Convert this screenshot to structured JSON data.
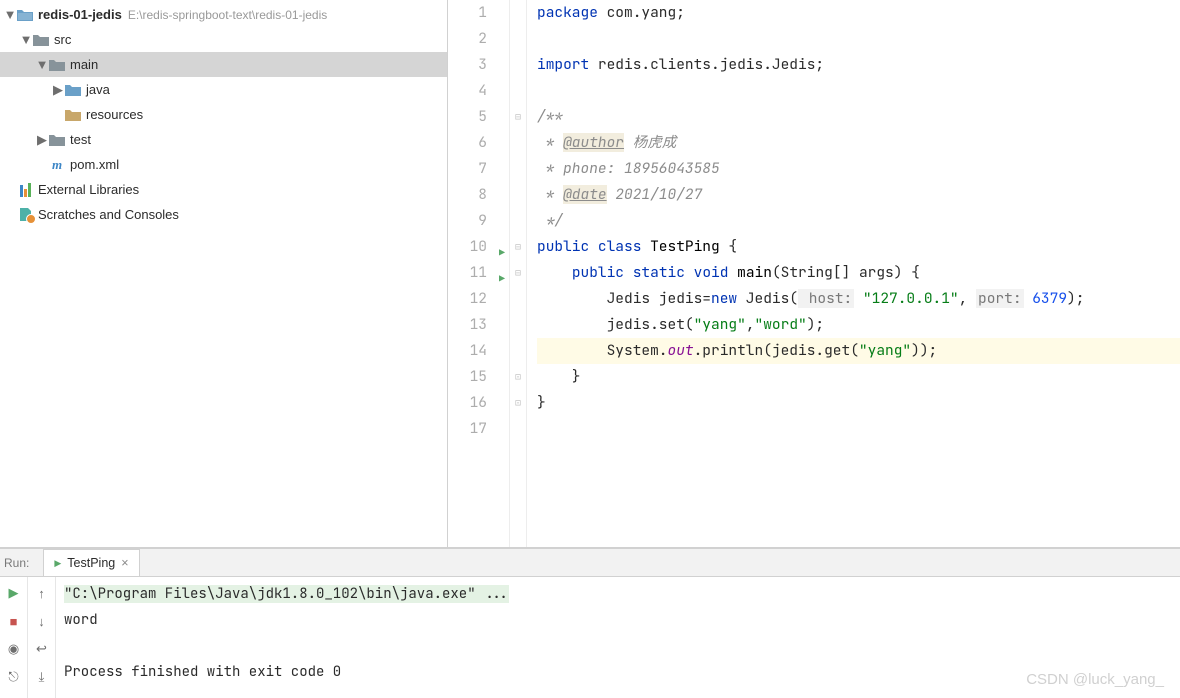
{
  "project": {
    "root_name": "redis-01-jedis",
    "root_path": "E:\\redis-springboot-text\\redis-01-jedis",
    "nodes": {
      "src": "src",
      "main": "main",
      "java": "java",
      "resources": "resources",
      "test": "test",
      "pom": "pom.xml",
      "ext_lib": "External Libraries",
      "scratch": "Scratches and Consoles"
    }
  },
  "editor": {
    "lines": [
      {
        "n": 1
      },
      {
        "n": 2
      },
      {
        "n": 3
      },
      {
        "n": 4
      },
      {
        "n": 5
      },
      {
        "n": 6
      },
      {
        "n": 7
      },
      {
        "n": 8
      },
      {
        "n": 9
      },
      {
        "n": 10,
        "run": true
      },
      {
        "n": 11,
        "run": true
      },
      {
        "n": 12
      },
      {
        "n": 13
      },
      {
        "n": 14,
        "hl": true
      },
      {
        "n": 15
      },
      {
        "n": 16
      },
      {
        "n": 17
      }
    ],
    "code": {
      "l1_kw": "package",
      "l1_pkg": " com.yang;",
      "l3_kw": "import",
      "l3_rest": " redis.clients.jedis.Jedis;",
      "l5": "/**",
      "l6_pre": " * ",
      "l6_anno": "@author",
      "l6_post": " 杨虎成",
      "l7": " * phone: 18956043585",
      "l8_pre": " * ",
      "l8_anno": "@date",
      "l8_post": " 2021/10/27",
      "l9": " */",
      "l10_kw1": "public",
      "l10_kw2": "class",
      "l10_name": "TestPing",
      "l10_brace": "{",
      "l11_kw1": "public",
      "l11_kw2": "static",
      "l11_kw3": "void",
      "l11_name": "main",
      "l11_args": "(String[] args) {",
      "l12_pre": "        Jedis jedis=",
      "l12_new": "new",
      "l12_cls": " Jedis(",
      "l12_p1": " host:",
      "l12_s1": "\"127.0.0.1\"",
      "l12_c": ", ",
      "l12_p2": "port:",
      "l12_n": "6379",
      "l12_end": ");",
      "l13_pre": "        jedis.set(",
      "l13_s1": "\"yang\"",
      "l13_c": ",",
      "l13_s2": "\"word\"",
      "l13_end": ");",
      "l14_pre": "        System.",
      "l14_out": "out",
      "l14_pr": ".println(jedis.get(",
      "l14_s": "\"yang\"",
      "l14_end": "));",
      "l15": "    }",
      "l16": "}"
    }
  },
  "run": {
    "title": "Run:",
    "tab": "TestPing",
    "cmd": "\"C:\\Program Files\\Java\\jdk1.8.0_102\\bin\\java.exe\" ...",
    "out1": "word",
    "out2": "Process finished with exit code 0"
  },
  "watermark": "CSDN @luck_yang_"
}
